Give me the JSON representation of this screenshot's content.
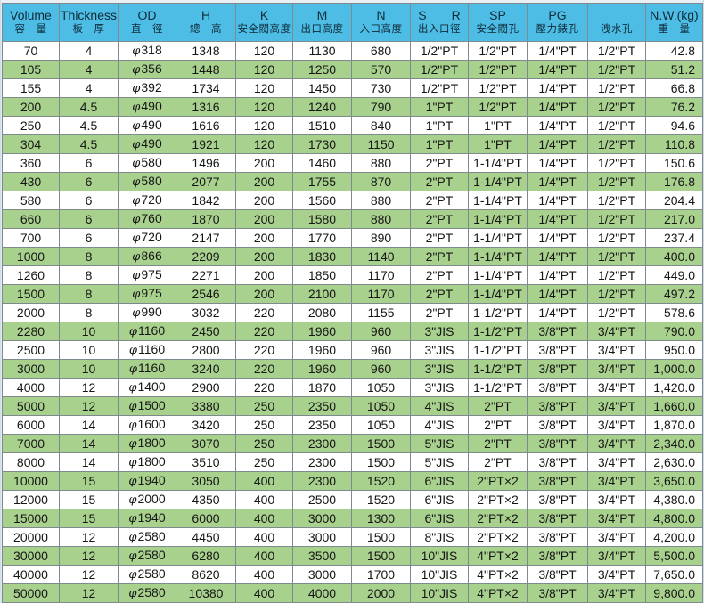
{
  "headers": [
    {
      "en": "Volume",
      "zh": "容　量"
    },
    {
      "en": "Thickness",
      "zh": "板　厚"
    },
    {
      "en": "OD",
      "zh": "直　徑"
    },
    {
      "en": "H",
      "zh": "總　高"
    },
    {
      "en": "K",
      "zh": "安全閥高度"
    },
    {
      "en": "M",
      "zh": "出口高度"
    },
    {
      "en": "N",
      "zh": "入口高度"
    },
    {
      "en": "S　　R",
      "zh": "出入口徑"
    },
    {
      "en": "SP",
      "zh": "安全閥孔"
    },
    {
      "en": "PG",
      "zh": "壓力錶孔"
    },
    {
      "en": "",
      "zh": "洩水孔"
    },
    {
      "en": "N.W.(kg)",
      "zh": "重　量"
    }
  ],
  "od_symbol": "φ",
  "rows": [
    [
      "70",
      "4",
      "318",
      "1348",
      "120",
      "1130",
      "680",
      "1/2\"PT",
      "1/2\"PT",
      "1/4\"PT",
      "1/2\"PT",
      "42.8"
    ],
    [
      "105",
      "4",
      "356",
      "1448",
      "120",
      "1250",
      "570",
      "1/2\"PT",
      "1/2\"PT",
      "1/4\"PT",
      "1/2\"PT",
      "51.2"
    ],
    [
      "155",
      "4",
      "392",
      "1734",
      "120",
      "1450",
      "730",
      "1/2\"PT",
      "1/2\"PT",
      "1/4\"PT",
      "1/2\"PT",
      "66.8"
    ],
    [
      "200",
      "4.5",
      "490",
      "1316",
      "120",
      "1240",
      "790",
      "1\"PT",
      "1/2\"PT",
      "1/4\"PT",
      "1/2\"PT",
      "76.2"
    ],
    [
      "250",
      "4.5",
      "490",
      "1616",
      "120",
      "1510",
      "840",
      "1\"PT",
      "1\"PT",
      "1/4\"PT",
      "1/2\"PT",
      "94.6"
    ],
    [
      "304",
      "4.5",
      "490",
      "1921",
      "120",
      "1730",
      "1150",
      "1\"PT",
      "1\"PT",
      "1/4\"PT",
      "1/2\"PT",
      "110.8"
    ],
    [
      "360",
      "6",
      "580",
      "1496",
      "200",
      "1460",
      "880",
      "2\"PT",
      "1-1/4\"PT",
      "1/4\"PT",
      "1/2\"PT",
      "150.6"
    ],
    [
      "430",
      "6",
      "580",
      "2077",
      "200",
      "1755",
      "870",
      "2\"PT",
      "1-1/4\"PT",
      "1/4\"PT",
      "1/2\"PT",
      "176.8"
    ],
    [
      "580",
      "6",
      "720",
      "1842",
      "200",
      "1560",
      "880",
      "2\"PT",
      "1-1/4\"PT",
      "1/4\"PT",
      "1/2\"PT",
      "204.4"
    ],
    [
      "660",
      "6",
      "760",
      "1870",
      "200",
      "1580",
      "880",
      "2\"PT",
      "1-1/4\"PT",
      "1/4\"PT",
      "1/2\"PT",
      "217.0"
    ],
    [
      "700",
      "6",
      "720",
      "2147",
      "200",
      "1770",
      "890",
      "2\"PT",
      "1-1/4\"PT",
      "1/4\"PT",
      "1/2\"PT",
      "237.4"
    ],
    [
      "1000",
      "8",
      "866",
      "2209",
      "200",
      "1830",
      "1140",
      "2\"PT",
      "1-1/4\"PT",
      "1/4\"PT",
      "1/2\"PT",
      "400.0"
    ],
    [
      "1260",
      "8",
      "975",
      "2271",
      "200",
      "1850",
      "1170",
      "2\"PT",
      "1-1/4\"PT",
      "1/4\"PT",
      "1/2\"PT",
      "449.0"
    ],
    [
      "1500",
      "8",
      "975",
      "2546",
      "200",
      "2100",
      "1170",
      "2\"PT",
      "1-1/4\"PT",
      "1/4\"PT",
      "1/2\"PT",
      "497.2"
    ],
    [
      "2000",
      "8",
      "990",
      "3032",
      "220",
      "2080",
      "1155",
      "2\"PT",
      "1-1/2\"PT",
      "1/4\"PT",
      "1/2\"PT",
      "578.6"
    ],
    [
      "2280",
      "10",
      "1160",
      "2450",
      "220",
      "1960",
      "960",
      "3\"JIS",
      "1-1/2\"PT",
      "3/8\"PT",
      "3/4\"PT",
      "790.0"
    ],
    [
      "2500",
      "10",
      "1160",
      "2800",
      "220",
      "1960",
      "960",
      "3\"JIS",
      "1-1/2\"PT",
      "3/8\"PT",
      "3/4\"PT",
      "950.0"
    ],
    [
      "3000",
      "10",
      "1160",
      "3240",
      "220",
      "1960",
      "960",
      "3\"JIS",
      "1-1/2\"PT",
      "3/8\"PT",
      "3/4\"PT",
      "1,000.0"
    ],
    [
      "4000",
      "12",
      "1400",
      "2900",
      "220",
      "1870",
      "1050",
      "3\"JIS",
      "1-1/2\"PT",
      "3/8\"PT",
      "3/4\"PT",
      "1,420.0"
    ],
    [
      "5000",
      "12",
      "1500",
      "3380",
      "250",
      "2350",
      "1050",
      "4\"JIS",
      "2\"PT",
      "3/8\"PT",
      "3/4\"PT",
      "1,660.0"
    ],
    [
      "6000",
      "14",
      "1600",
      "3420",
      "250",
      "2350",
      "1050",
      "4\"JIS",
      "2\"PT",
      "3/8\"PT",
      "3/4\"PT",
      "1,870.0"
    ],
    [
      "7000",
      "14",
      "1800",
      "3070",
      "250",
      "2300",
      "1500",
      "5\"JIS",
      "2\"PT",
      "3/8\"PT",
      "3/4\"PT",
      "2,340.0"
    ],
    [
      "8000",
      "14",
      "1800",
      "3510",
      "250",
      "2300",
      "1500",
      "5\"JIS",
      "2\"PT",
      "3/8\"PT",
      "3/4\"PT",
      "2,630.0"
    ],
    [
      "10000",
      "15",
      "1940",
      "3050",
      "400",
      "2300",
      "1520",
      "6\"JIS",
      "2\"PT×2",
      "3/8\"PT",
      "3/4\"PT",
      "3,650.0"
    ],
    [
      "12000",
      "15",
      "2000",
      "4350",
      "400",
      "2500",
      "1520",
      "6\"JIS",
      "2\"PT×2",
      "3/8\"PT",
      "3/4\"PT",
      "4,380.0"
    ],
    [
      "15000",
      "15",
      "1940",
      "6000",
      "400",
      "3000",
      "1300",
      "6\"JIS",
      "2\"PT×2",
      "3/8\"PT",
      "3/4\"PT",
      "4,800.0"
    ],
    [
      "20000",
      "12",
      "2580",
      "4450",
      "400",
      "3000",
      "1500",
      "8\"JIS",
      "2\"PT×2",
      "3/8\"PT",
      "3/4\"PT",
      "4,200.0"
    ],
    [
      "30000",
      "12",
      "2580",
      "6280",
      "400",
      "3500",
      "1500",
      "10\"JIS",
      "4\"PT×2",
      "3/8\"PT",
      "3/4\"PT",
      "5,500.0"
    ],
    [
      "40000",
      "12",
      "2580",
      "8620",
      "400",
      "3000",
      "1700",
      "10\"JIS",
      "4\"PT×2",
      "3/8\"PT",
      "3/4\"PT",
      "7,650.0"
    ],
    [
      "50000",
      "12",
      "2580",
      "10380",
      "400",
      "4000",
      "2000",
      "10\"JIS",
      "4\"PT×2",
      "3/8\"PT",
      "3/4\"PT",
      "9,800.0"
    ]
  ],
  "colors": {
    "header": "#4dbde5",
    "row_white": "#ffffff",
    "row_green": "#a9d18e",
    "border": "#7f8a8f"
  }
}
